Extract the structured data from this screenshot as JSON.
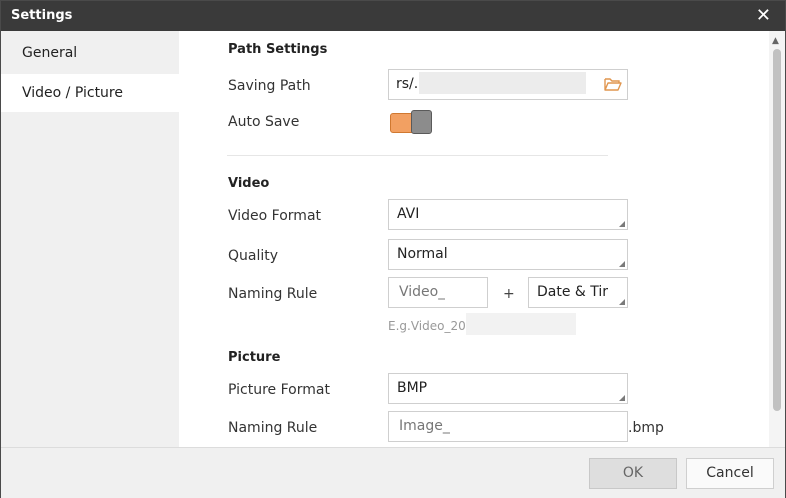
{
  "window": {
    "title": "Settings"
  },
  "sidebar": {
    "items": [
      {
        "label": "General"
      },
      {
        "label": "Video / Picture"
      }
    ]
  },
  "path_settings": {
    "heading": "Path Settings",
    "saving_path_label": "Saving Path",
    "saving_path_value": "rs/.",
    "auto_save_label": "Auto Save",
    "auto_save_on": true
  },
  "video": {
    "heading": "Video",
    "format_label": "Video Format",
    "format_value": "AVI",
    "quality_label": "Quality",
    "quality_value": "Normal",
    "naming_label": "Naming Rule",
    "naming_prefix_placeholder": "Video_",
    "plus": "+",
    "naming_suffix_value": "Date & Tir",
    "example": "E.g.Video_202"
  },
  "picture": {
    "heading": "Picture",
    "format_label": "Picture Format",
    "format_value": "BMP",
    "naming_label": "Naming Rule",
    "naming_prefix_placeholder": "Image_",
    "extension": ".bmp"
  },
  "footer": {
    "ok_label": "OK",
    "cancel_label": "Cancel"
  },
  "colors": {
    "toggle_on": "#f2a062",
    "titlebar": "#3a3a3a",
    "folder_icon": "#e0964f"
  }
}
